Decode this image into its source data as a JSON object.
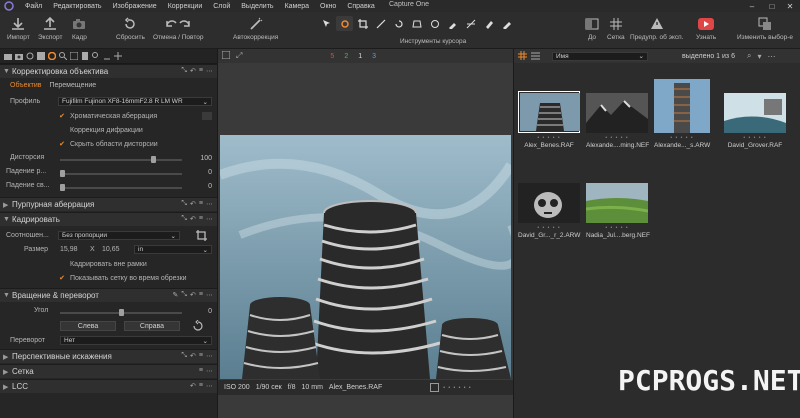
{
  "menubar": {
    "items": [
      "Файл",
      "Редактировать",
      "Изображение",
      "Коррекции",
      "Слой",
      "Выделить",
      "Камера",
      "Окно",
      "Справка"
    ],
    "app_title": "Capture One"
  },
  "toolbar": {
    "import": "Импорт",
    "export": "Экспорт",
    "capture": "Кадр",
    "reset": "Сбросить",
    "undo_redo": "Отмена / Повтор",
    "autocorrect": "Автокоррекция",
    "cursor_tools": "Инструменты курсора",
    "before": "До",
    "grid": "Сетка",
    "exposure_warning": "Предупр. об эксп.",
    "learn": "Узнать",
    "change_selection": "Изменить выбор-е"
  },
  "viewer": {
    "counters": [
      "5",
      "2",
      "1",
      "3"
    ],
    "counter_colors": [
      "#e04646",
      "#3cc04a",
      "#d8d8d8",
      "#4aa0e8"
    ],
    "iso": "ISO 200",
    "shutter": "1/90 сек",
    "aperture": "f/8",
    "focal": "10 mm",
    "filename": "Alex_Benes.RAF",
    "dots": "• • • • • •"
  },
  "left_panel": {
    "lens_section": {
      "title": "Корректировка объектива",
      "tab_lens": "Объектив",
      "tab_movement": "Перемещение",
      "profile_label": "Профиль",
      "profile_value": "Fujifilm Fujinon XF8-16mmF2.8 R LM WR",
      "chk_chromatic": "Хроматическая аберрация",
      "chk_diffraction": "Коррекция дифракции",
      "chk_hide_distortion": "Скрыть области дисторсии",
      "distortion_label": "Дисторсия",
      "distortion_value": "100",
      "distortion_level": 0.78,
      "falloff_r_label": "Падение р...",
      "falloff_r_value": "0",
      "falloff_r_level": 0.0,
      "falloff_s_label": "Падение св...",
      "falloff_s_value": "0",
      "falloff_s_level": 0.0
    },
    "purple_section": {
      "title": "Пурпурная аберрация"
    },
    "crop_section": {
      "title": "Кадрировать",
      "ratio_label": "Соотношен...",
      "ratio_value": "Без пропорции",
      "size_label": "Размер",
      "width": "15,98",
      "x": "X",
      "height": "10,65",
      "unit": "in",
      "chk_crop_outside": "Кадрировать вне рамки",
      "chk_show_grid": "Показывать сетку во время обрезки"
    },
    "rotation_section": {
      "title": "Вращение & переворот",
      "angle_label": "Угол",
      "angle_value": "0",
      "angle_level": 0.5,
      "left_btn": "Слева",
      "right_btn": "Справа",
      "flip_label": "Переворот",
      "flip_value": "Нет"
    },
    "perspective_section": {
      "title": "Перспективные искажения"
    },
    "grid_section": {
      "title": "Сетка"
    },
    "lcc_section": {
      "title": "LCC"
    }
  },
  "browser": {
    "sort_value": "Имя",
    "selected_text": "выделено 1 из 6",
    "thumbs": [
      {
        "name": "Alex_Benes.RAF",
        "selected": true
      },
      {
        "name": "Alexande....ming.NEF",
        "selected": false
      },
      {
        "name": "Alexande..._s.ARW",
        "selected": false
      },
      {
        "name": "David_Grover.RAF",
        "selected": false
      },
      {
        "name": "David_Gr..._r_2.ARW",
        "selected": false
      },
      {
        "name": "Nadia_Jul....berg.NEF",
        "selected": false
      }
    ],
    "dots": "• • • • •"
  },
  "watermark": "PCPROGS.NET",
  "colors": {
    "accent": "#f08a2c",
    "panel": "#262626",
    "header": "#2f2f2f"
  }
}
